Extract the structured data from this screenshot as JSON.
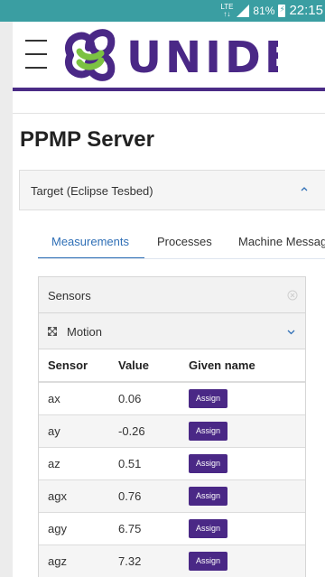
{
  "status_bar": {
    "network": "LTE",
    "battery": "81%",
    "time": "22:15"
  },
  "header": {
    "logo_text": "UNIDE"
  },
  "page": {
    "title": "PPMP Server"
  },
  "target_card": {
    "title": "Target (Eclipse Tesbed)"
  },
  "tabs": [
    {
      "label": "Measurements",
      "active": true
    },
    {
      "label": "Processes",
      "active": false
    },
    {
      "label": "Machine Messages",
      "active": false
    }
  ],
  "sensors": {
    "label": "Sensors",
    "group": "Motion",
    "columns": [
      "Sensor",
      "Value",
      "Given name"
    ],
    "rows": [
      {
        "sensor": "ax",
        "value": "0.06",
        "action": "Assign"
      },
      {
        "sensor": "ay",
        "value": "-0.26",
        "action": "Assign"
      },
      {
        "sensor": "az",
        "value": "0.51",
        "action": "Assign"
      },
      {
        "sensor": "agx",
        "value": "0.76",
        "action": "Assign"
      },
      {
        "sensor": "agy",
        "value": "6.75",
        "action": "Assign"
      },
      {
        "sensor": "agz",
        "value": "7.32",
        "action": "Assign"
      }
    ]
  },
  "colors": {
    "status_bar": "#3a9ea2",
    "brand_purple": "#4a2886",
    "brand_green": "#7cc242",
    "tab_active": "#2f6fb6"
  }
}
